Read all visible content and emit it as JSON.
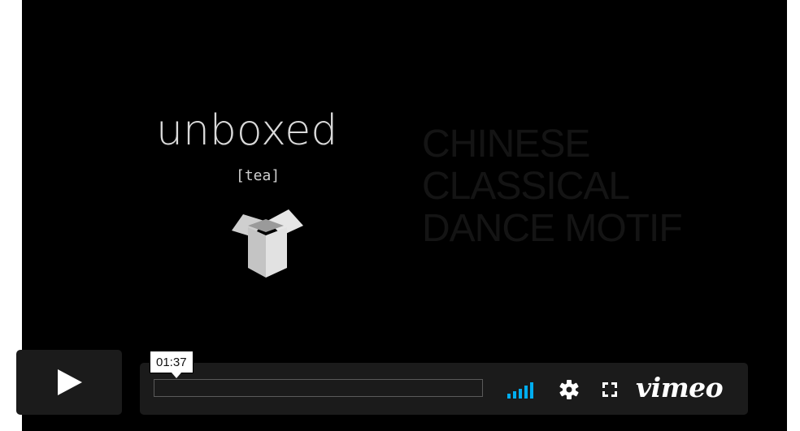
{
  "video": {
    "logo": {
      "word": "unboxed",
      "sub": "[tea]",
      "icon": "open-box-icon"
    },
    "title_lines": [
      "CHINESE",
      "CLASSICAL",
      "DANCE MOTIF"
    ]
  },
  "controls": {
    "play_icon": "play-icon",
    "timestamp": "01:37",
    "progress_fraction": 0.0,
    "volume_icon": "volume-bars-icon",
    "settings_icon": "gear-icon",
    "fullscreen_icon": "fullscreen-icon",
    "brand": "vimeo"
  },
  "colors": {
    "background": "#000000",
    "control_bg": "#1b1b1b",
    "accent": "#00adef",
    "icon": "#ffffff"
  }
}
